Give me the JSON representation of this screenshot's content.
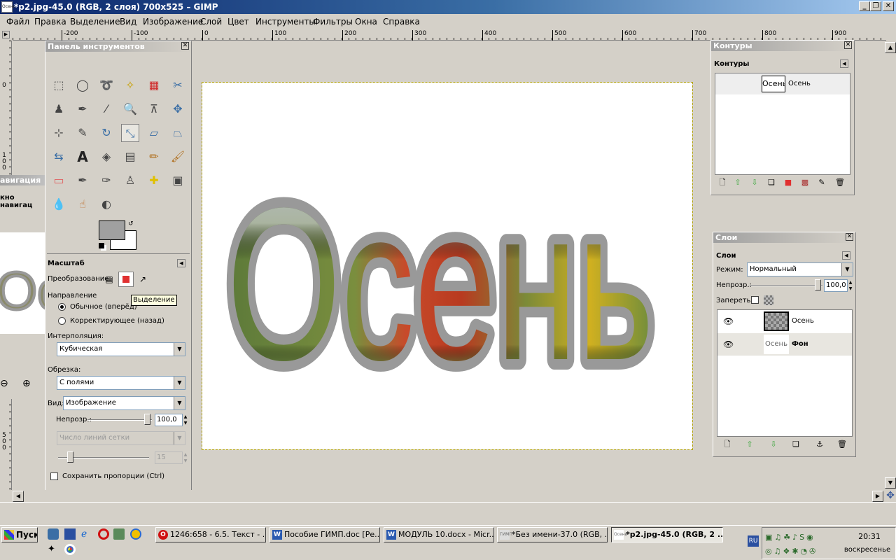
{
  "window": {
    "title": "*p2.jpg-45.0 (RGB, 2 слоя) 700x525 – GIMP"
  },
  "menu": [
    "Файл",
    "Правка",
    "Выделение",
    "Вид",
    "Изображение",
    "Слой",
    "Цвет",
    "Инструменты",
    "Фильтры",
    "Окна",
    "Справка"
  ],
  "hruler": [
    "-200",
    "-100",
    "0",
    "100",
    "200",
    "300",
    "400",
    "500",
    "600",
    "700",
    "800",
    "900"
  ],
  "vruler": [
    "0",
    "1\n0\n0",
    "5\n0\n0"
  ],
  "canvas": {
    "text": "Осень"
  },
  "nav": {
    "title": "авигация",
    "sub": "кно навигац"
  },
  "toolbox": {
    "title": "Панель инструментов",
    "options_title": "Масштаб",
    "transform_label": "Преобразование:",
    "direction_label": "Направление",
    "dir_normal": "Обычное (вперёд)",
    "dir_corrective": "Корректирующее (назад)",
    "tooltip": "Выделение",
    "interp_label": "Интерполяция:",
    "interp_value": "Кубическая",
    "clip_label": "Обрезка:",
    "clip_value": "С полями",
    "view_label": "Вид:",
    "view_value": "Изображение",
    "opacity_label": "Непрозр.:",
    "opacity_value": "100,0",
    "grid_value": "Число линий сетки",
    "grid_num": "15",
    "keep_label": "Сохранить пропорции  (Ctrl)",
    "tools": [
      "rect-select",
      "ellipse-select",
      "lasso",
      "fuzzy-select",
      "color-select",
      "scissors",
      "foreground-select",
      "paths",
      "color-picker",
      "zoom",
      "measure",
      "move",
      "align",
      "crop",
      "rotate",
      "scale",
      "shear",
      "perspective",
      "flip",
      "text",
      "bucket-fill",
      "blend",
      "pencil",
      "paintbrush",
      "eraser",
      "airbrush",
      "ink",
      "clone",
      "heal",
      "perspective-clone",
      "blur",
      "smudge",
      "dodge-burn"
    ]
  },
  "paths": {
    "title": "Контуры",
    "tab": "Контуры",
    "item": "Осень",
    "item_thumb": "Осень"
  },
  "layers": {
    "title": "Слои",
    "tab": "Слои",
    "mode_label": "Режим:",
    "mode_value": "Нормальный",
    "opacity_label": "Непрозр.:",
    "opacity_value": "100,0",
    "lock_label": "Запереть:",
    "items": [
      {
        "name": "Осень",
        "thumb": ""
      },
      {
        "name": "Фон",
        "thumb": "Осень"
      }
    ]
  },
  "taskbar": {
    "start": "Пуск",
    "buttons": [
      "1246:658 - 6.5. Текст - ...",
      "Пособие ГИМП.doc [Ре...",
      "МОДУЛЬ 10.docx - Micr...",
      "*Без имени-37.0 (RGB, ...",
      "*p2.jpg-45.0 (RGB, 2 ..."
    ],
    "time": "20:31",
    "day": "воскресенье",
    "lang": "RU"
  },
  "colors": {
    "titlebar": "#0a246a",
    "bg": "#d4d0c8"
  }
}
